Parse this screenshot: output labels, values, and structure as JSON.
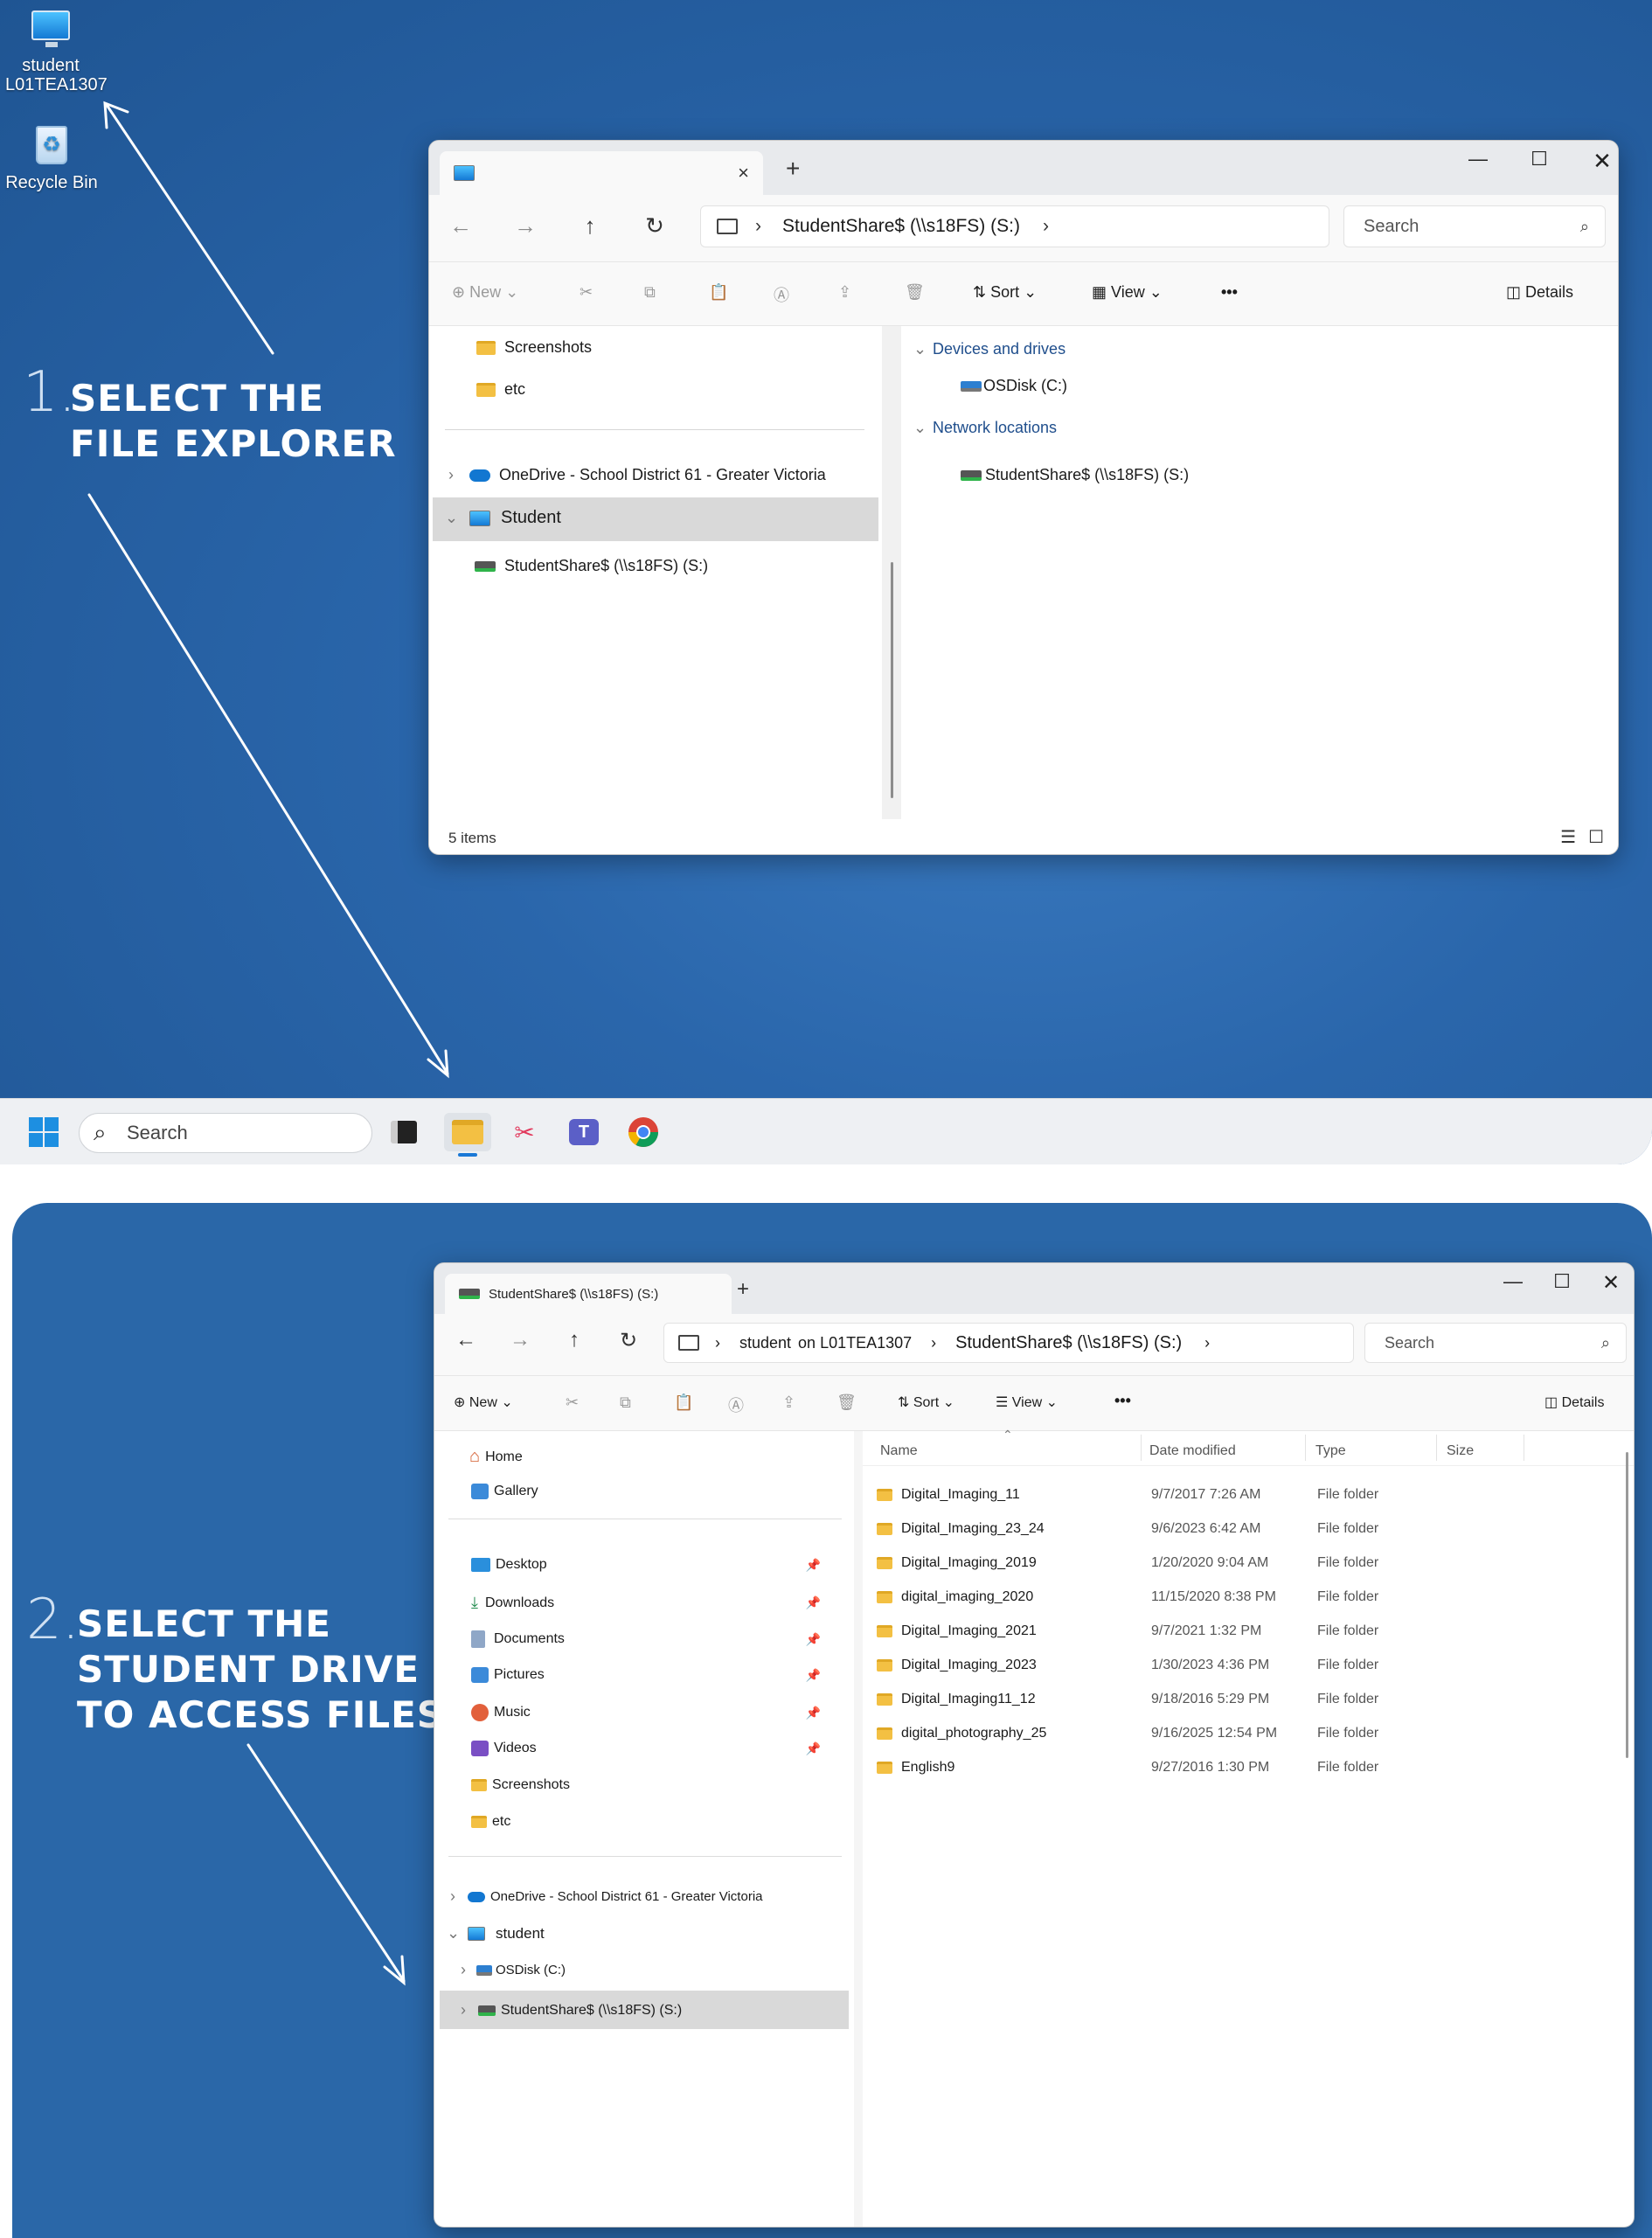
{
  "desktop": {
    "pc_icon_label_1": "student",
    "pc_icon_label_2": "L01TEA1307",
    "recycle_label": "Recycle Bin"
  },
  "step1": {
    "num": "1.",
    "line1": "SELECT THE",
    "line2": "FILE EXPLORER"
  },
  "step2": {
    "num": "2.",
    "line1": "SELECT THE",
    "line2": "STUDENT DRIVE",
    "line3": "TO ACCESS FILES"
  },
  "win1": {
    "tab_title": "",
    "address_seg1": "StudentShare$ (\\\\s18FS) (S:)",
    "search_placeholder": "Search",
    "cmd": {
      "new": "New",
      "sort": "Sort",
      "view": "View",
      "more": "•••",
      "details": "Details"
    },
    "nav": {
      "screenshots": "Screenshots",
      "etc": "etc",
      "onedrive": "OneDrive - School District 61 - Greater Victoria",
      "student": "Student",
      "studentshare": "StudentShare$ (\\\\s18FS) (S:)"
    },
    "groups": {
      "devices": "Devices and drives",
      "osdisk": "OSDisk (C:)",
      "network": "Network locations",
      "studentshare": "StudentShare$ (\\\\s18FS) (S:)"
    },
    "status": "5 items"
  },
  "taskbar": {
    "search": "Search"
  },
  "win2": {
    "tab_title": "StudentShare$ (\\\\s18FS) (S:)",
    "address_seg1": "student",
    "address_on": "on L01TEA1307",
    "address_seg2": "StudentShare$ (\\\\s18FS) (S:)",
    "search_placeholder": "Search",
    "cmd": {
      "new": "New",
      "sort": "Sort",
      "view": "View",
      "more": "•••",
      "details": "Details"
    },
    "nav": {
      "home": "Home",
      "gallery": "Gallery",
      "desktop": "Desktop",
      "downloads": "Downloads",
      "documents": "Documents",
      "pictures": "Pictures",
      "music": "Music",
      "videos": "Videos",
      "screenshots": "Screenshots",
      "etc": "etc",
      "onedrive": "OneDrive - School District 61 - Greater Victoria",
      "student": "student",
      "osdisk": "OSDisk (C:)",
      "studentshare": "StudentShare$ (\\\\s18FS) (S:)"
    },
    "columns": {
      "name": "Name",
      "date": "Date modified",
      "type": "Type",
      "size": "Size"
    },
    "rows": [
      {
        "name": "Digital_Imaging_11",
        "date": "9/7/2017 7:26 AM",
        "type": "File folder"
      },
      {
        "name": "Digital_Imaging_23_24",
        "date": "9/6/2023 6:42 AM",
        "type": "File folder"
      },
      {
        "name": "Digital_Imaging_2019",
        "date": "1/20/2020 9:04 AM",
        "type": "File folder"
      },
      {
        "name": "digital_imaging_2020",
        "date": "11/15/2020 8:38 PM",
        "type": "File folder"
      },
      {
        "name": "Digital_Imaging_2021",
        "date": "9/7/2021 1:32 PM",
        "type": "File folder"
      },
      {
        "name": "Digital_Imaging_2023",
        "date": "1/30/2023 4:36 PM",
        "type": "File folder"
      },
      {
        "name": "Digital_Imaging11_12",
        "date": "9/18/2016 5:29 PM",
        "type": "File folder"
      },
      {
        "name": "digital_photography_25",
        "date": "9/16/2025 12:54 PM",
        "type": "File folder"
      },
      {
        "name": "English9",
        "date": "9/27/2016 1:30 PM",
        "type": "File folder"
      }
    ]
  }
}
